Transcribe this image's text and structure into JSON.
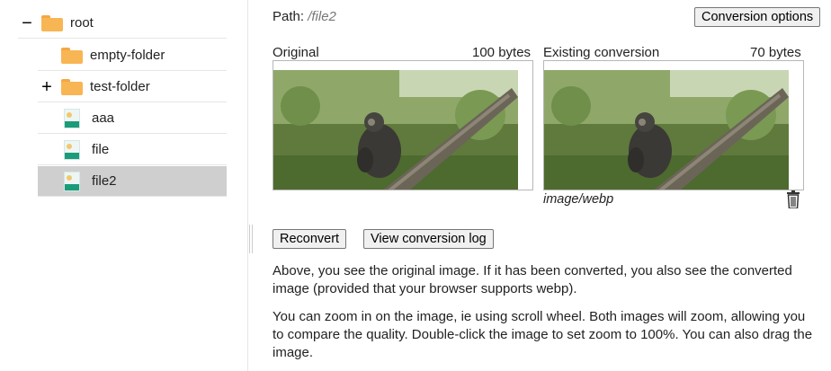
{
  "tree": {
    "items": [
      {
        "toggle": "−",
        "label": "root"
      },
      {
        "toggle": "",
        "label": "empty-folder"
      },
      {
        "toggle": "+",
        "label": "test-folder"
      },
      {
        "toggle": "",
        "label": "aaa"
      },
      {
        "toggle": "",
        "label": "file"
      },
      {
        "toggle": "",
        "label": "file2"
      }
    ]
  },
  "main": {
    "path_label": "Path: ",
    "path_value": "/file2",
    "conversion_options_label": "Conversion options",
    "original": {
      "title": "Original",
      "size": "100 bytes"
    },
    "converted": {
      "title": "Existing conversion",
      "size": "70 bytes",
      "mime": "image/webp"
    },
    "reconvert_label": "Reconvert",
    "view_log_label": "View conversion log",
    "paragraph1": "Above, you see the original image. If it has been converted, you also see the converted image (provided that your browser supports webp).",
    "paragraph2": "You can zoom in on the image, ie using scroll wheel. Both images will zoom, allowing you to compare the quality. Double-click the image to set zoom to 100%. You can also drag the image."
  },
  "icons": {
    "folder": "folder-icon",
    "image_file": "image-file-icon",
    "trash": "trash-icon"
  },
  "colors": {
    "selected_row": "#cfcfcf",
    "folder": "#f8b553",
    "image_icon_green": "#1a9c7a"
  }
}
